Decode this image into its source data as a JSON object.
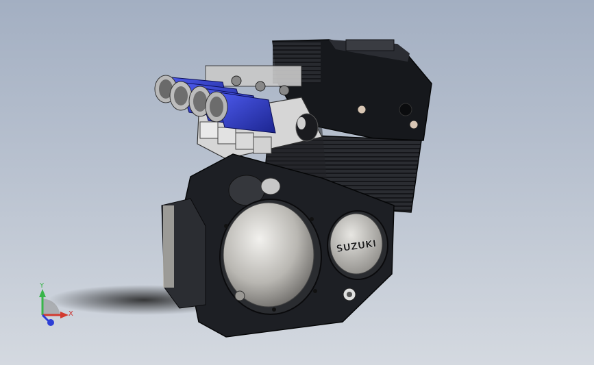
{
  "viewport": {
    "background_top": "#a3afc2",
    "background_bottom": "#d4d9e0"
  },
  "model": {
    "brand_text": "SUZUKI",
    "filter_color": "#2f3fd4",
    "case_color": "#bdbbb6",
    "body_color": "#1d1f24"
  },
  "triad": {
    "x_label": "X",
    "y_label": "Y",
    "x_color": "#d33a2f",
    "y_color": "#39b54a",
    "z_color": "#2d3fd6"
  }
}
